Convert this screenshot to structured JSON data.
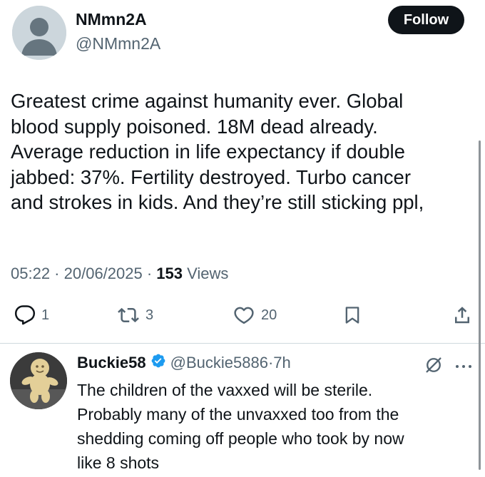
{
  "tweet": {
    "author": {
      "display_name": "NMmn2A",
      "handle": "@NMmn2A"
    },
    "follow_label": "Follow",
    "text_lines": [
      "Greatest crime against humanity ever. Global",
      "blood supply poisoned. 18M dead already.",
      "Average reduction in life expectancy if double",
      "jabbed: 37%. Fertility destroyed. Turbo cancer",
      "and strokes in kids. And they’re still sticking ppl,"
    ],
    "meta": {
      "time": "05:22",
      "sep1": " · ",
      "date": "20/06/2025",
      "sep2": " · ",
      "views_count": "153",
      "views_label": " Views"
    },
    "actions": {
      "replies": "1",
      "reposts": "3",
      "likes": "20"
    }
  },
  "reply": {
    "display_name": "Buckie58",
    "handle": "@Buckie5886",
    "dot": " · ",
    "time": "7h",
    "text_lines": [
      "The children of the vaxxed will be sterile.",
      "Probably many of the unvaxxed too from the",
      "shedding coming off people who took by now",
      "like 8 shots"
    ]
  },
  "colors": {
    "text_primary": "#0f1419",
    "text_secondary": "#536471",
    "follow_bg": "#0f1419",
    "verified": "#1d9bf0",
    "divider": "#cfd9de",
    "avatar_placeholder": "#ccd6dc"
  },
  "icons": {
    "reply": "speech-bubble-icon",
    "repost": "retweet-arrows-icon",
    "like": "heart-outline-icon",
    "bookmark": "bookmark-outline-icon",
    "share": "share-upload-icon",
    "verified": "verified-badge-icon",
    "grok": "grok-slash-icon",
    "more": "more-dots-icon"
  }
}
